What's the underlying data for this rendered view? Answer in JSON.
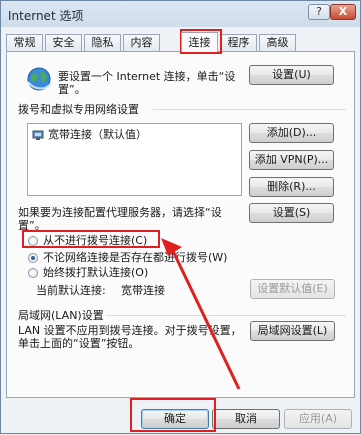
{
  "window": {
    "title": "Internet 选项",
    "help_label": "?",
    "close_label": "X"
  },
  "tabs": [
    "常规",
    "安全",
    "隐私",
    "内容",
    "连接",
    "程序",
    "高级"
  ],
  "setup": {
    "text": "要设置一个 Internet 连接，单击“设置”。",
    "button": "设置(U)"
  },
  "dialup": {
    "heading": "拨号和虚拟专用网络设置",
    "list_items": [
      "宽带连接（默认值）"
    ],
    "add_button": "添加(D)...",
    "add_vpn_button": "添加 VPN(P)...",
    "remove_button": "删除(R)...",
    "proxy_text": "如果要为连接配置代理服务器，请选择“设置”。",
    "settings_button": "设置(S)",
    "options": [
      {
        "label": "从不进行拨号连接(C)",
        "selected": false
      },
      {
        "label": "不论网络连接是否存在都进行拨号(W)",
        "selected": true
      },
      {
        "label": "始终拨打默认连接(O)",
        "selected": false
      }
    ],
    "current_default_label": "当前默认连接:",
    "current_default_value": "宽带连接",
    "set_default_button": "设置默认值(E)"
  },
  "lan": {
    "heading": "局域网(LAN)设置",
    "text": "LAN 设置不应用到拨号连接。对于拨号设置，单击上面的“设置”按钮。",
    "button": "局域网设置(L)"
  },
  "footer": {
    "ok": "确定",
    "cancel": "取消",
    "apply": "应用(A)"
  },
  "colors": {
    "annotation_red": "#e02020"
  }
}
